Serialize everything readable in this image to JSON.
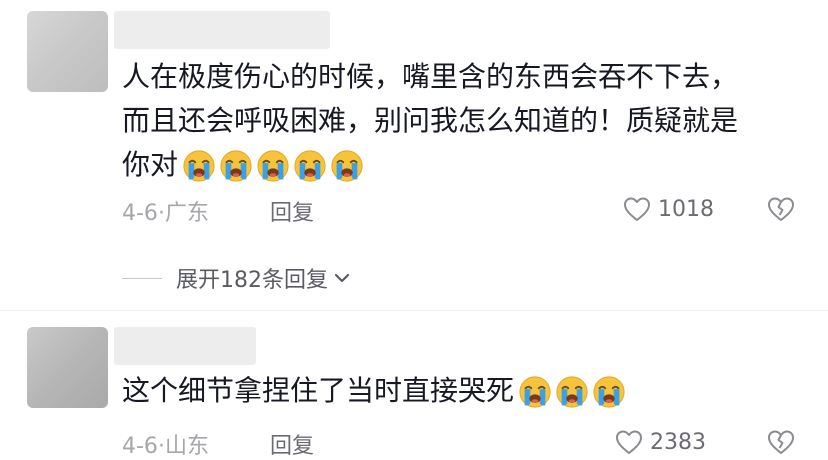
{
  "comments": [
    {
      "lines": [
        "人在极度伤心的时候，嘴里含的东西会吞不下去，",
        "而且还会呼吸困难，别问我怎么知道的！质疑就是",
        "你对"
      ],
      "emoji_icon": "loudly-crying-face-icon",
      "emoji_count": 5,
      "date": "4-6",
      "separator": "·",
      "location": "广东",
      "reply_label": "回复",
      "likes": "1018"
    },
    {
      "lines": [
        "这个细节拿捏住了当时直接哭死"
      ],
      "emoji_icon": "loudly-crying-face-icon",
      "emoji_count": 3,
      "date": "4-6",
      "separator": "·",
      "location": "山东",
      "reply_label": "回复",
      "likes": "2383"
    }
  ],
  "expand_replies": {
    "label": "展开182条回复"
  },
  "colors": {
    "text": "#161823",
    "meta": "#a6a7ab",
    "action": "#6b6c73",
    "emoji_face": "#f6c33c",
    "emoji_tears": "#3ba0e6"
  }
}
